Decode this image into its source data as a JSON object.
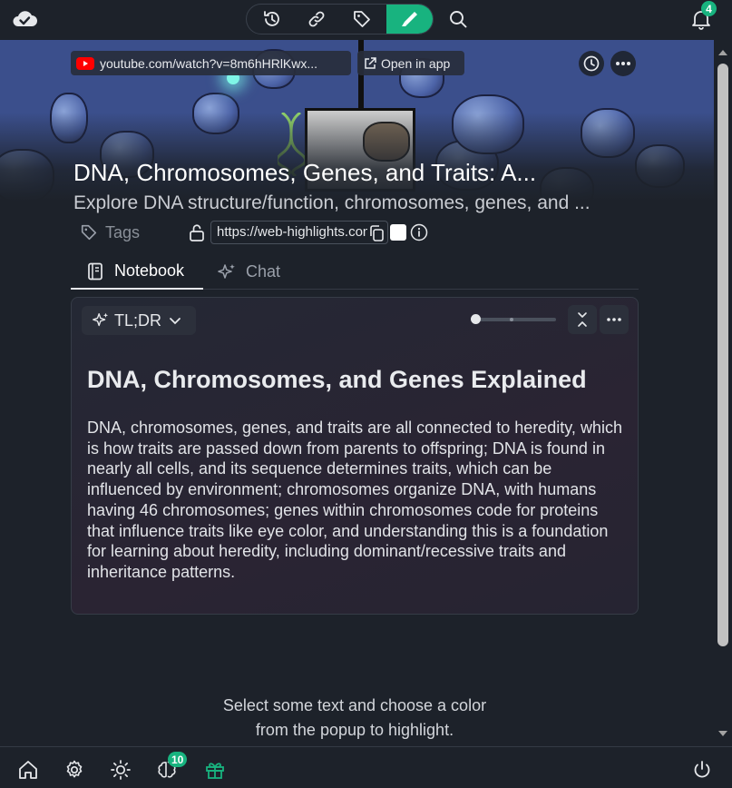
{
  "toolbar": {
    "items": [
      "history",
      "link",
      "tag",
      "highlight",
      "search"
    ],
    "active": "highlight"
  },
  "notifications": {
    "count": "4"
  },
  "source": {
    "url_display": "youtube.com/watch?v=8m6hHRlKwx...",
    "open_in_app": "Open in app"
  },
  "video": {
    "title": "DNA, Chromosomes, Genes, and Traits: A...",
    "description": "Explore DNA structure/function, chromosomes, genes, and ..."
  },
  "meta": {
    "tags_label": "Tags",
    "share_url": "https://web-highlights.com"
  },
  "tabs": [
    {
      "label": "Notebook",
      "active": true
    },
    {
      "label": "Chat",
      "active": false
    }
  ],
  "summary": {
    "mode_label": "TL;DR",
    "level": 0.0,
    "heading": "DNA, Chromosomes, and Genes Explained",
    "body": "DNA, chromosomes, genes, and traits are all connected to heredity, which is how traits are passed down from parents to offspring; DNA is found in nearly all cells, and its sequence determines traits, which can be influenced by environment; chromosomes organize DNA, with humans having 46 chromosomes; genes within chromosomes code for proteins that influence traits like eye color, and understanding this is a foundation for learning about heredity, including dominant/recessive traits and inheritance patterns."
  },
  "hint": {
    "line1": "Select some text and choose a color",
    "line2": "from the popup to highlight."
  },
  "bottom_bar": {
    "ai_badge": "10"
  },
  "colors": {
    "accent": "#18b37f",
    "background": "#1d222a",
    "youtube_red": "#ff0000"
  }
}
